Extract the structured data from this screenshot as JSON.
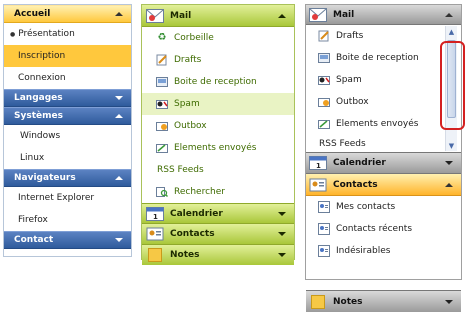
{
  "panel1": {
    "sections": [
      {
        "header": "Accueil",
        "expanded": true,
        "items": [
          {
            "label": "Présentation",
            "selected": false,
            "bullet": true
          },
          {
            "label": "Inscription",
            "selected": true,
            "bullet": false
          },
          {
            "label": "Connexion",
            "selected": false,
            "bullet": false
          }
        ]
      },
      {
        "header": "Langages",
        "expanded": false,
        "items": []
      },
      {
        "header": "Systèmes",
        "expanded": true,
        "items": [
          {
            "label": "Windows",
            "selected": false,
            "bullet": false
          },
          {
            "label": "Linux",
            "selected": false,
            "bullet": false
          }
        ]
      },
      {
        "header": "Navigateurs",
        "expanded": true,
        "items": [
          {
            "label": "Internet Explorer",
            "selected": false,
            "bullet": false
          },
          {
            "label": "Firefox",
            "selected": false,
            "bullet": false
          }
        ]
      },
      {
        "header": "Contact",
        "expanded": false,
        "items": []
      }
    ]
  },
  "panel2": {
    "mail_header": "Mail",
    "items": [
      {
        "label": "Corbeille",
        "icon": "recycle-icon"
      },
      {
        "label": "Drafts",
        "icon": "drafts-icon"
      },
      {
        "label": "Boite de reception",
        "icon": "inbox-icon"
      },
      {
        "label": "Spam",
        "icon": "spam-icon",
        "selected": true
      },
      {
        "label": "Outbox",
        "icon": "outbox-icon"
      },
      {
        "label": "Elements envoyés",
        "icon": "sent-icon"
      },
      {
        "label": "RSS Feeds",
        "icon": ""
      },
      {
        "label": "Rechercher",
        "icon": "search-icon"
      }
    ],
    "calendar_header": "Calendrier",
    "contacts_header": "Contacts",
    "notes_header": "Notes"
  },
  "panel3": {
    "mail_header": "Mail",
    "mail_items": [
      {
        "label": "Drafts",
        "icon": "drafts-icon"
      },
      {
        "label": "Boite de reception",
        "icon": "inbox-icon"
      },
      {
        "label": "Spam",
        "icon": "spam-icon"
      },
      {
        "label": "Outbox",
        "icon": "outbox-icon"
      },
      {
        "label": "Elements envoyés",
        "icon": "sent-icon"
      },
      {
        "label": "RSS Feeds",
        "icon": ""
      }
    ],
    "calendar_header": "Calendrier",
    "contacts_header": "Contacts",
    "contact_items": [
      {
        "label": "Mes contacts",
        "icon": "contacts-icon"
      },
      {
        "label": "Contacts récents",
        "icon": "recent-contacts-icon"
      },
      {
        "label": "Indésirables",
        "icon": "blocked-contacts-icon"
      }
    ],
    "notes_header": "Notes"
  }
}
